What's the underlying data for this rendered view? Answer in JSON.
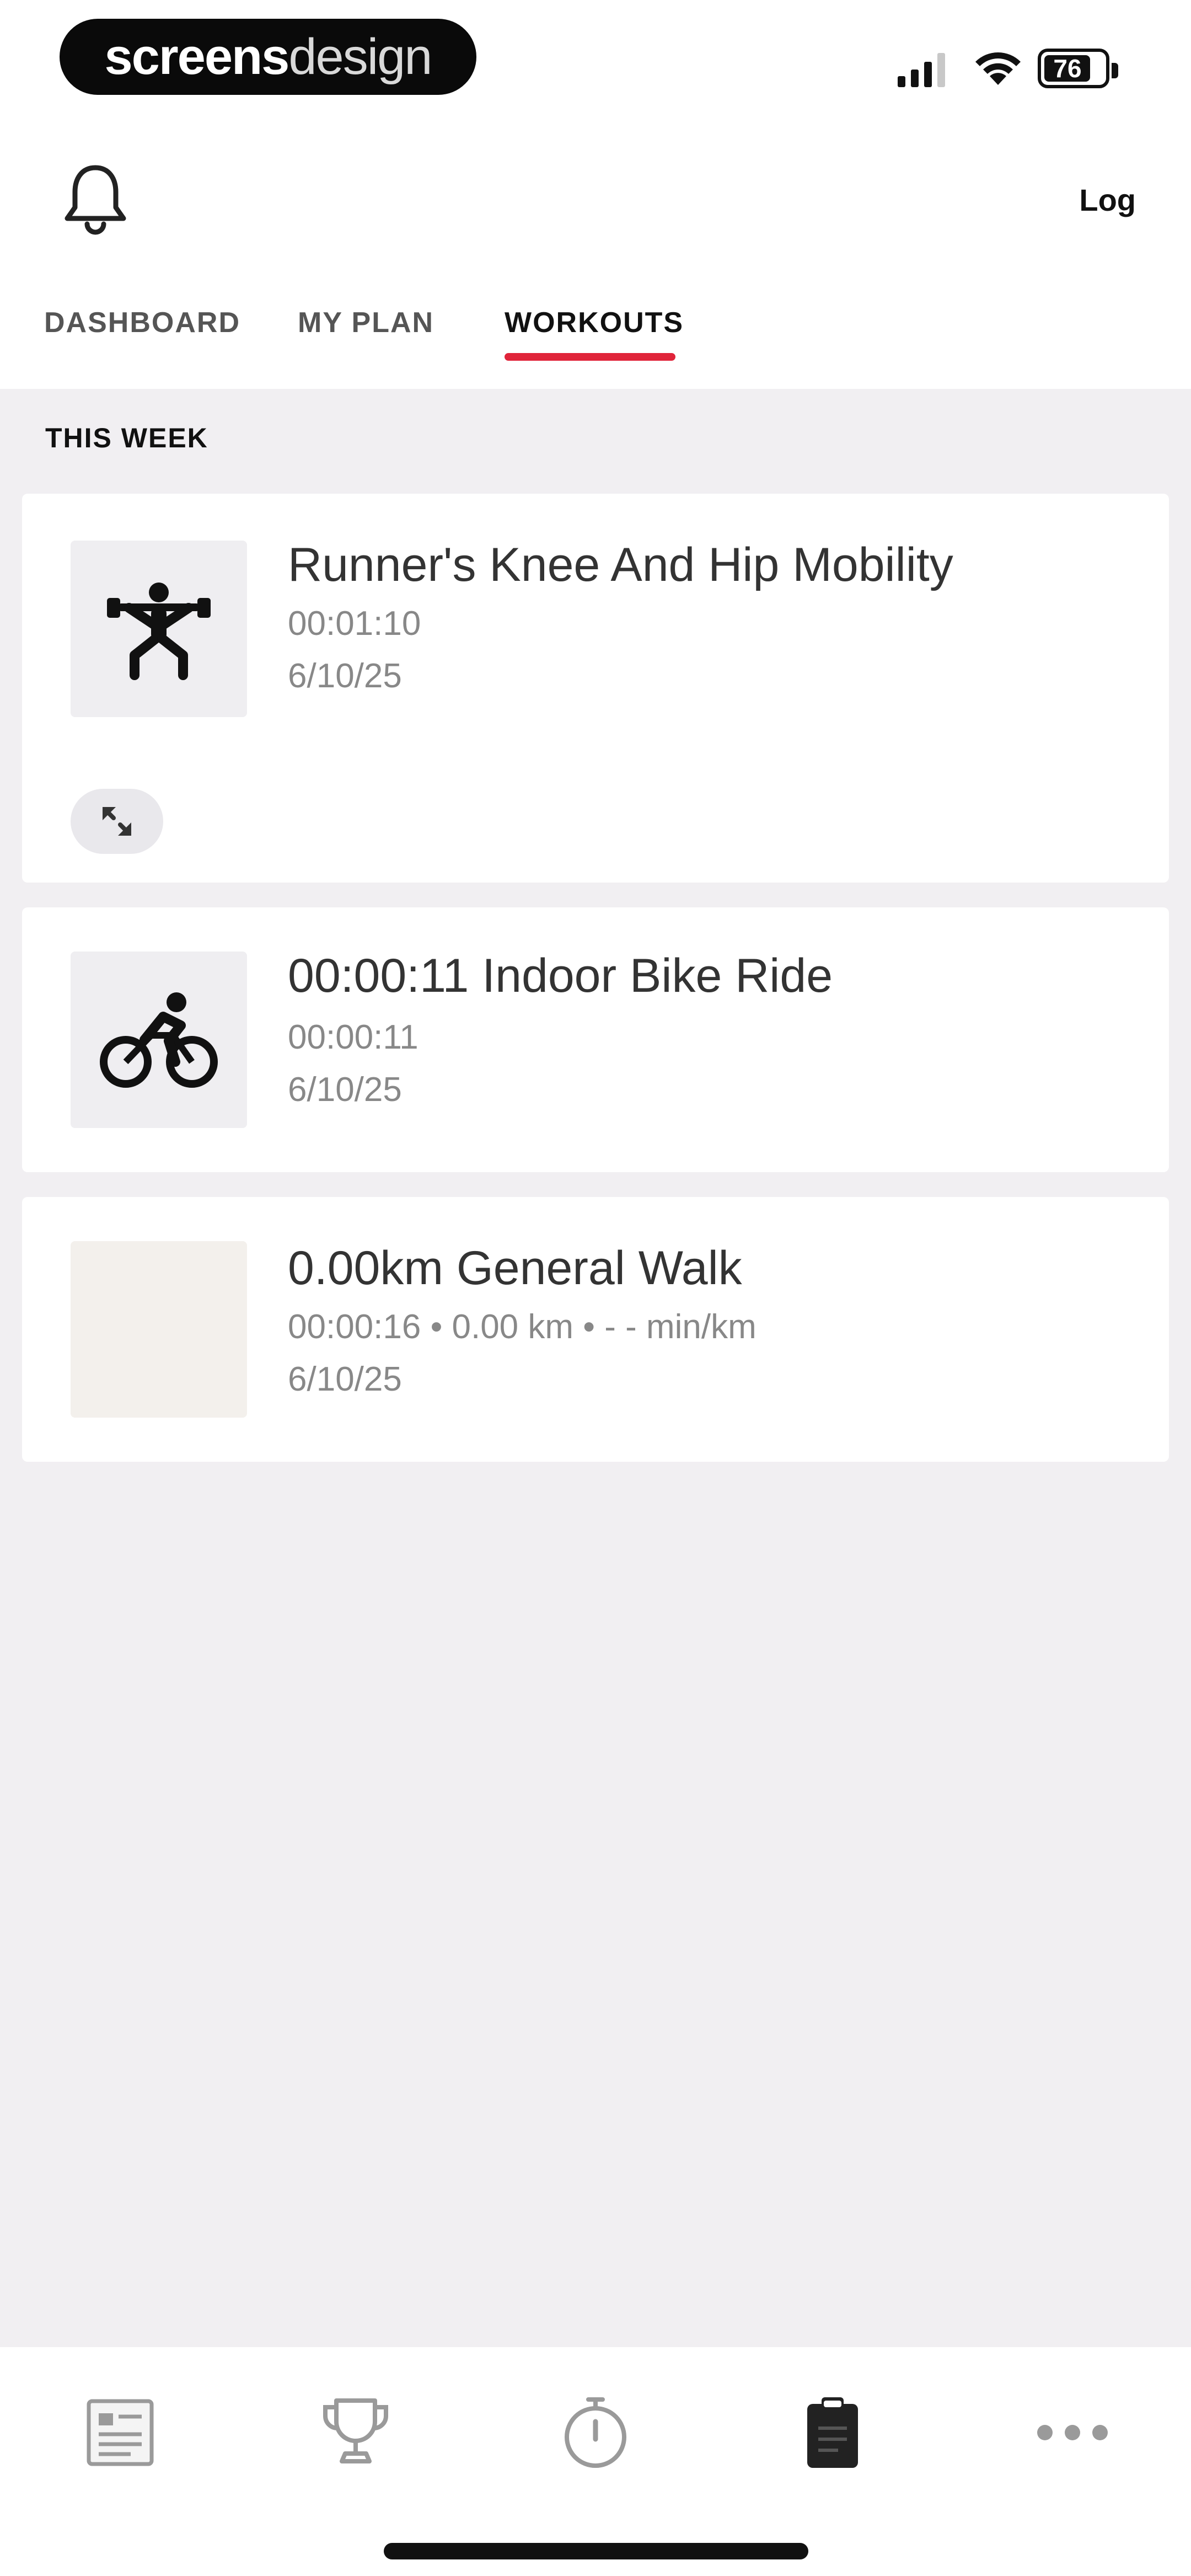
{
  "status_bar": {
    "brand_part1": "screens",
    "brand_part2": "design",
    "battery_level": "76"
  },
  "header": {
    "log_label": "Log"
  },
  "tabs": [
    {
      "label": "DASHBOARD",
      "active": false
    },
    {
      "label": "MY PLAN",
      "active": false
    },
    {
      "label": "WORKOUTS",
      "active": true
    }
  ],
  "section": {
    "label": "THIS WEEK"
  },
  "workouts": [
    {
      "icon": "weightlifting-icon",
      "title": "Runner's Knee And Hip Mobility",
      "duration": "00:01:10",
      "date": "6/10/25"
    },
    {
      "icon": "cycling-icon",
      "title": "00:00:11 Indoor Bike Ride",
      "duration": "00:00:11",
      "date": "6/10/25"
    },
    {
      "icon": "map-thumbnail",
      "title": "0.00km General Walk",
      "duration": "00:00:16 • 0.00 km • - - min/km",
      "date": "6/10/25"
    }
  ],
  "bottom_nav": [
    {
      "icon": "feed-icon",
      "active": false
    },
    {
      "icon": "trophy-icon",
      "active": false
    },
    {
      "icon": "stopwatch-icon",
      "active": false
    },
    {
      "icon": "clipboard-icon",
      "active": true
    },
    {
      "icon": "more-icon",
      "active": false
    }
  ],
  "colors": {
    "accent": "#e0243a",
    "background": "#f1eff2",
    "card": "#ffffff"
  }
}
